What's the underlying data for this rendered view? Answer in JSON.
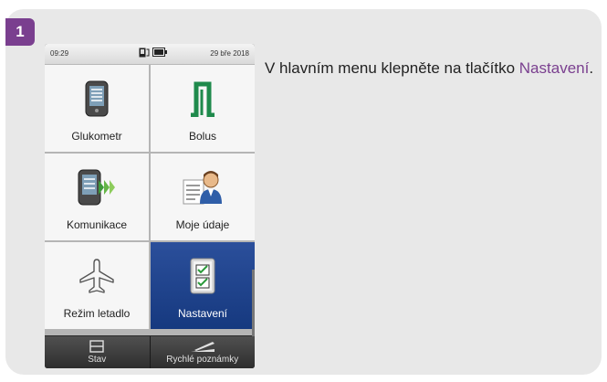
{
  "step": {
    "number": "1"
  },
  "device": {
    "status": {
      "time": "09:29",
      "date": "29 bře 2018"
    },
    "tiles": [
      {
        "label": "Glukometr",
        "icon": "meter-icon",
        "active": false
      },
      {
        "label": "Bolus",
        "icon": "bolus-icon",
        "active": false
      },
      {
        "label": "Komunikace",
        "icon": "communication-icon",
        "active": false
      },
      {
        "label": "Moje údaje",
        "icon": "my-data-icon",
        "active": false
      },
      {
        "label": "Režim letadlo",
        "icon": "airplane-icon",
        "active": false
      },
      {
        "label": "Nastavení",
        "icon": "settings-checklist-icon",
        "active": true
      }
    ],
    "bottom": [
      {
        "label": "Stav",
        "icon": "status-icon"
      },
      {
        "label": "Rychlé poznámky",
        "icon": "quick-notes-icon"
      }
    ]
  },
  "instruction": {
    "text_before": "V hlavním menu klepněte na tlačítko",
    "link": "Nastavení",
    "text_after": "."
  },
  "colors": {
    "accent": "#7a3f8f",
    "active_tile": "#1e4590",
    "card": "#e8e8e8"
  }
}
